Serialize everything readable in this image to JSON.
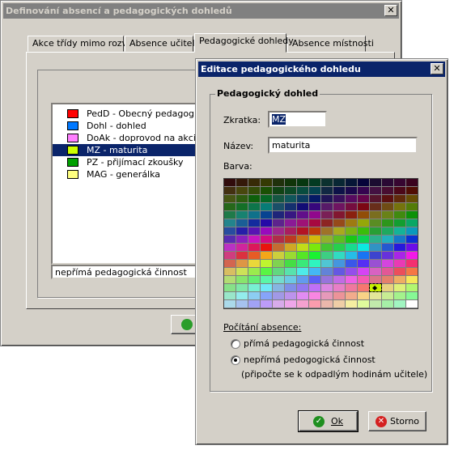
{
  "main_window": {
    "title": "Definování absencí a pedagogických dohledů",
    "close_glyph": "✕",
    "tabs": [
      {
        "label": "Akce třídy mimo rozvrh"
      },
      {
        "label": "Absence učitele"
      },
      {
        "label": "Pedagogické dohledy"
      },
      {
        "label": "Absence místnosti"
      }
    ],
    "active_tab": "Pedagogické dohledy",
    "list_items": [
      {
        "label": "PedD - Obecný pedagogický",
        "color": "#ff0000"
      },
      {
        "label": "Dohl - dohled",
        "color": "#0078ff"
      },
      {
        "label": "DoAk - doprovod na akci",
        "color": "#ff80ff"
      },
      {
        "label": "MZ - maturita",
        "color": "#ccff00",
        "selected": true
      },
      {
        "label": "PZ - přijímací zkoušky",
        "color": "#00a000"
      },
      {
        "label": "MAG - generálka",
        "color": "#ffff80"
      }
    ],
    "status_text": "nepřímá pedagogická činnost"
  },
  "dialog": {
    "title": "Editace pedagogického dohledu",
    "close_glyph": "✕",
    "group_title": "Pedagogický dohled",
    "abbrev_label": "Zkratka:",
    "abbrev_value": "MZ",
    "name_label": "Název:",
    "name_value": "maturita",
    "color_label": "Barva:",
    "selected_color_marker": "◆",
    "counting_label": "Počítání absence:",
    "radio_direct": "přímá pedagogická činnost",
    "radio_indirect": "nepřímá pedogogická činnost",
    "radio_note": "(připočte se k odpadlým hodinám učitele)",
    "selected_counting": "indirect",
    "ok_label": "Ok",
    "cancel_label": "Storno",
    "ok_icon": "check-icon",
    "cancel_icon": "cancel-icon"
  }
}
